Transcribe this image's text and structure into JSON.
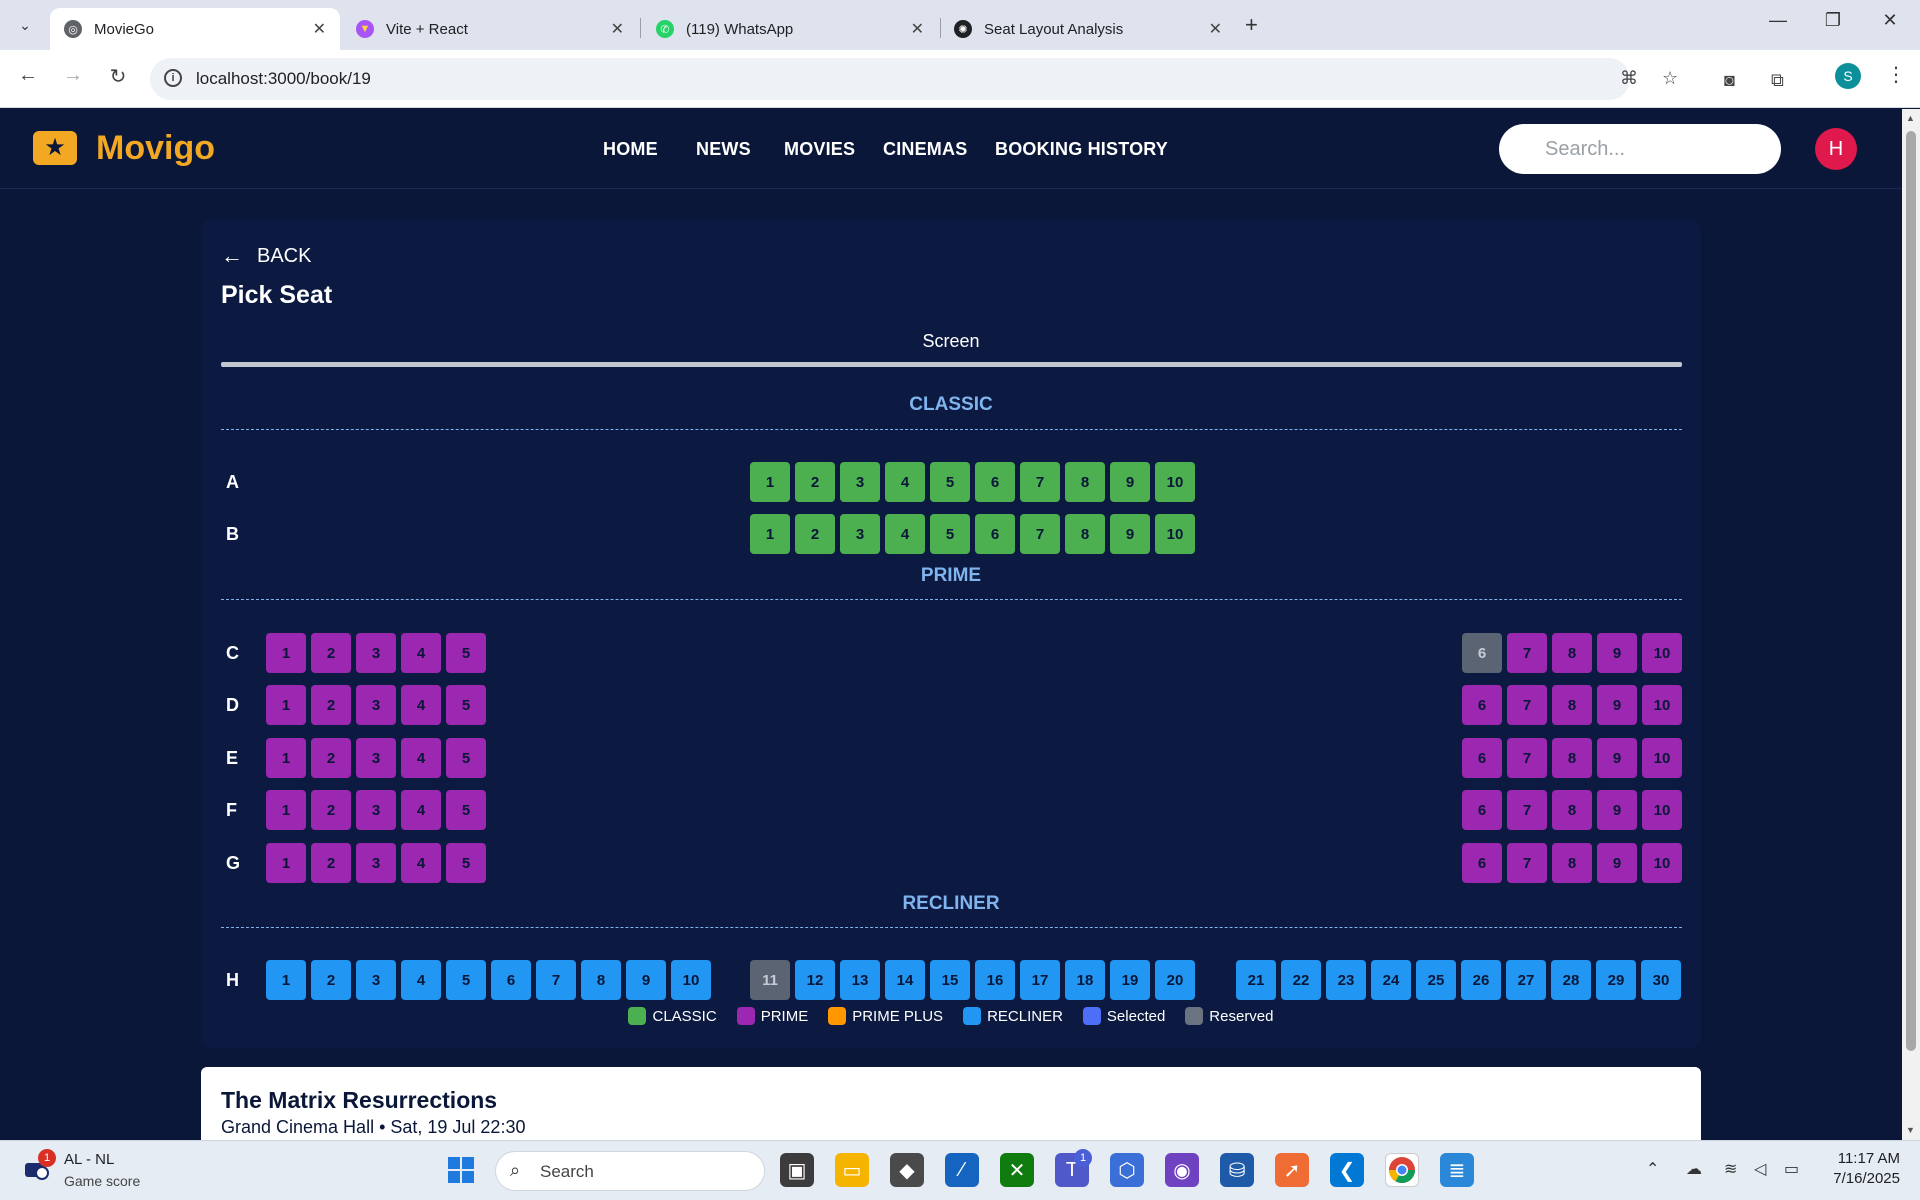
{
  "browser": {
    "tabs": [
      {
        "title": "MovieGo",
        "active": true
      },
      {
        "title": "Vite + React",
        "active": false
      },
      {
        "title": "(119) WhatsApp",
        "active": false
      },
      {
        "title": "Seat Layout Analysis",
        "active": false
      }
    ],
    "url": "localhost:3000/book/19",
    "profile_initial": "S"
  },
  "navbar": {
    "brand": "Movigo",
    "menu": [
      "HOME",
      "NEWS",
      "MOVIES",
      "CINEMAS",
      "BOOKING HISTORY"
    ],
    "search_placeholder": "Search...",
    "avatar_initial": "H"
  },
  "booking": {
    "back_label": "BACK",
    "title": "Pick Seat",
    "screen_label": "Screen",
    "sections": [
      {
        "name": "CLASSIC",
        "rows": [
          {
            "label": "A",
            "groups": [
              [
                "1",
                "2",
                "3",
                "4",
                "5",
                "6",
                "7",
                "8",
                "9",
                "10"
              ]
            ]
          },
          {
            "label": "B",
            "groups": [
              [
                "1",
                "2",
                "3",
                "4",
                "5",
                "6",
                "7",
                "8",
                "9",
                "10"
              ]
            ]
          }
        ]
      },
      {
        "name": "PRIME",
        "rows": [
          {
            "label": "C",
            "groups": [
              [
                "1",
                "2",
                "3",
                "4",
                "5"
              ],
              [
                "6",
                "7",
                "8",
                "9",
                "10"
              ]
            ]
          },
          {
            "label": "D",
            "groups": [
              [
                "1",
                "2",
                "3",
                "4",
                "5"
              ],
              [
                "6",
                "7",
                "8",
                "9",
                "10"
              ]
            ]
          },
          {
            "label": "E",
            "groups": [
              [
                "1",
                "2",
                "3",
                "4",
                "5"
              ],
              [
                "6",
                "7",
                "8",
                "9",
                "10"
              ]
            ]
          },
          {
            "label": "F",
            "groups": [
              [
                "1",
                "2",
                "3",
                "4",
                "5"
              ],
              [
                "6",
                "7",
                "8",
                "9",
                "10"
              ]
            ]
          },
          {
            "label": "G",
            "groups": [
              [
                "1",
                "2",
                "3",
                "4",
                "5"
              ],
              [
                "6",
                "7",
                "8",
                "9",
                "10"
              ]
            ]
          }
        ]
      },
      {
        "name": "RECLINER",
        "rows": [
          {
            "label": "H",
            "groups": [
              [
                "1",
                "2",
                "3",
                "4",
                "5",
                "6",
                "7",
                "8",
                "9",
                "10"
              ],
              [
                "11",
                "12",
                "13",
                "14",
                "15",
                "16",
                "17",
                "18",
                "19",
                "20"
              ],
              [
                "21",
                "22",
                "23",
                "24",
                "25",
                "26",
                "27",
                "28",
                "29",
                "30"
              ]
            ]
          }
        ]
      }
    ],
    "reserved": [
      "C6",
      "H11"
    ],
    "legend": [
      {
        "label": "CLASSIC",
        "color": "#4caf50"
      },
      {
        "label": "PRIME",
        "color": "#9c27b0"
      },
      {
        "label": "PRIME PLUS",
        "color": "#ff9800"
      },
      {
        "label": "RECLINER",
        "color": "#2196f3"
      },
      {
        "label": "Selected",
        "color": "#4f6ef7"
      },
      {
        "label": "Reserved",
        "color": "#6b7280"
      }
    ],
    "movie_title": "The Matrix Resurrections",
    "movie_meta": "Grand Cinema Hall • Sat, 19 Jul 22:30"
  },
  "taskbar": {
    "news_title": "AL - NL",
    "news_sub": "Game score",
    "news_badge": "1",
    "search_label": "Search",
    "teams_badge": "1",
    "time": "11:17 AM",
    "date": "7/16/2025"
  }
}
